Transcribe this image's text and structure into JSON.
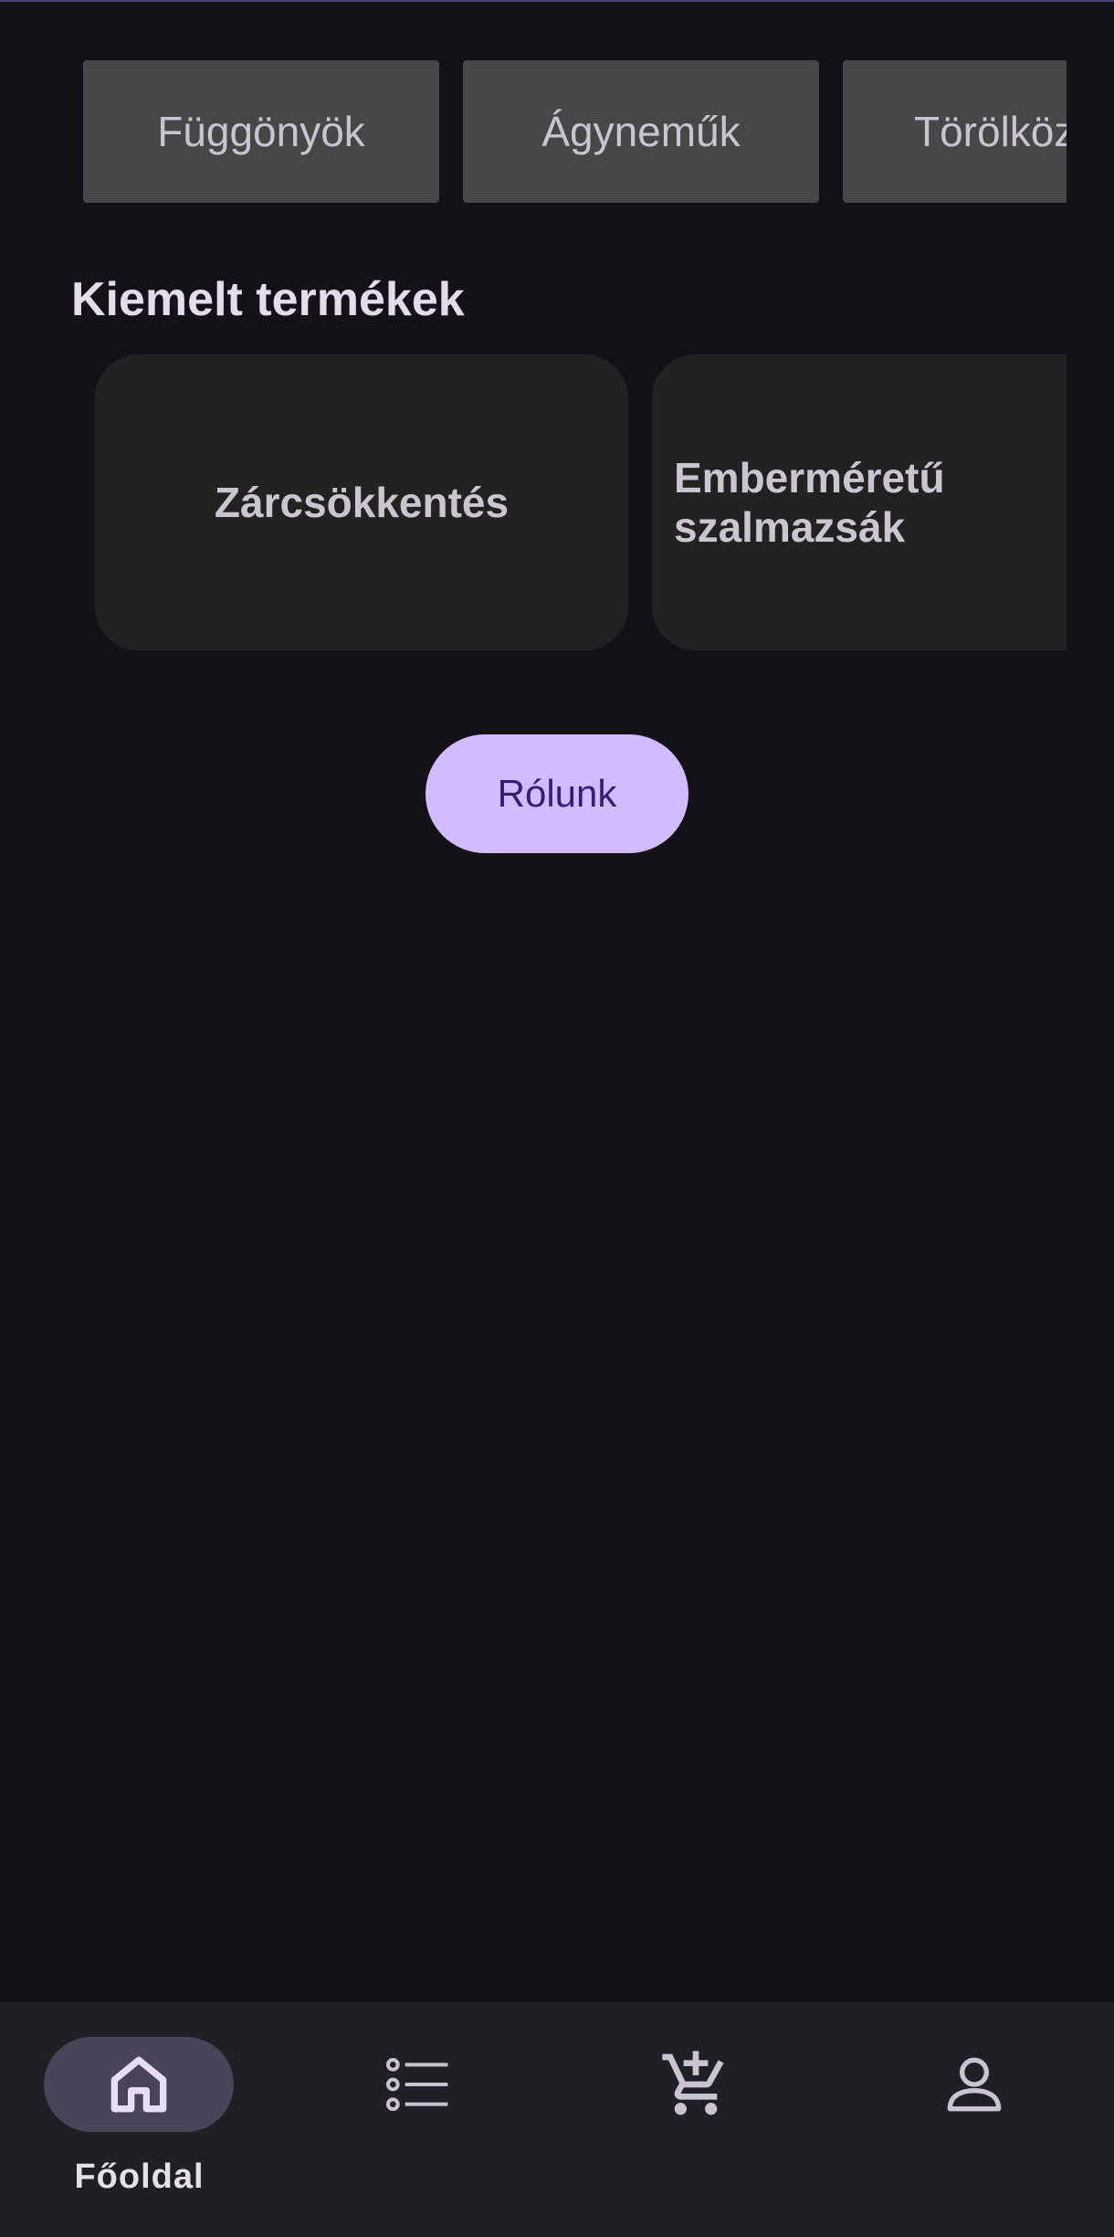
{
  "categories": {
    "items": [
      {
        "label": "Függönyök"
      },
      {
        "label": "Ágyneműk"
      },
      {
        "label": "Törölköz"
      }
    ]
  },
  "featured": {
    "title": "Kiemelt termékek",
    "items": [
      {
        "label": "Zárcsökkentés"
      },
      {
        "label": "Emberméretű szalmazsák"
      }
    ]
  },
  "about_button": {
    "label": "Rólunk"
  },
  "bottom_nav": {
    "items": [
      {
        "label": "Főoldal",
        "icon": "home-icon",
        "selected": true
      },
      {
        "label": "",
        "icon": "list-icon",
        "selected": false
      },
      {
        "label": "",
        "icon": "add-to-cart-icon",
        "selected": false
      },
      {
        "label": "",
        "icon": "person-icon",
        "selected": false
      }
    ]
  },
  "colors": {
    "background": "#141218",
    "chip": "#474747",
    "card": "#222222",
    "accent": "#d0bcff",
    "accent_text": "#381e72",
    "nav_background": "#211f26",
    "nav_indicator": "#4a4458"
  }
}
